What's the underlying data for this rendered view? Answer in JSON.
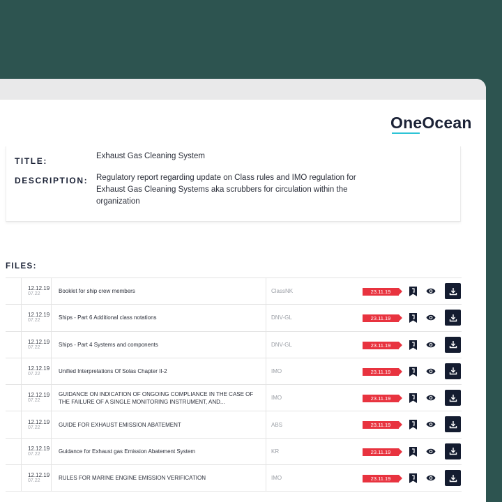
{
  "brand": {
    "logo_text": "OneOcean"
  },
  "details": {
    "title_label": "TITLE:",
    "title_value": "Exhaust Gas Cleaning System",
    "description_label": "DESCRIPTION:",
    "description_value": "Regulatory report regarding update on Class rules and IMO regulation for Exhaust Gas Cleaning Systems aka scrubbers for circulation within the organization"
  },
  "files": {
    "heading": "FILES:",
    "rows": [
      {
        "date": "12.12.19",
        "time": "07.22",
        "name": "Booklet for ship crew members",
        "source": "ClassNK",
        "badge": "23.11.19"
      },
      {
        "date": "12.12.19",
        "time": "07.22",
        "name": "Ships - Part 6 Additional class notations",
        "source": "DNV-GL",
        "badge": "23.11.19"
      },
      {
        "date": "12.12.19",
        "time": "07.22",
        "name": "Ships - Part 4 Systems and components",
        "source": "DNV-GL",
        "badge": "23.11.19"
      },
      {
        "date": "12.12.19",
        "time": "07.22",
        "name": "Unified Interpretations Of Solas Chapter II-2",
        "source": "IMO",
        "badge": "23.11.19"
      },
      {
        "date": "12.12.19",
        "time": "07.22",
        "name": "GUIDANCE ON INDICATION OF ONGOING COMPLIANCE IN THE CASE OF THE FAILURE OF A SINGLE MONITORING INSTRUMENT, AND...",
        "source": "IMO",
        "badge": "23.11.19"
      },
      {
        "date": "12.12.19",
        "time": "07.22",
        "name": "GUIDE FOR EXHAUST EMISSION ABATEMENT",
        "source": "ABS",
        "badge": "23.11.19"
      },
      {
        "date": "12.12.19",
        "time": "07.22",
        "name": "Guidance for Exhaust gas Emission Abatement System",
        "source": "KR",
        "badge": "23.11.19"
      },
      {
        "date": "12.12.19",
        "time": "07.22",
        "name": "RULES FOR MARINE ENGINE EMISSION VERIFICATION",
        "source": "IMO",
        "badge": "23.11.19"
      }
    ]
  },
  "icons": {
    "save": "bookmark-save-icon",
    "view": "eye-icon",
    "download": "download-icon"
  },
  "colors": {
    "background": "#2d5450",
    "accent": "#2ec4d6",
    "badge": "#e8333f",
    "dark": "#141c30"
  }
}
